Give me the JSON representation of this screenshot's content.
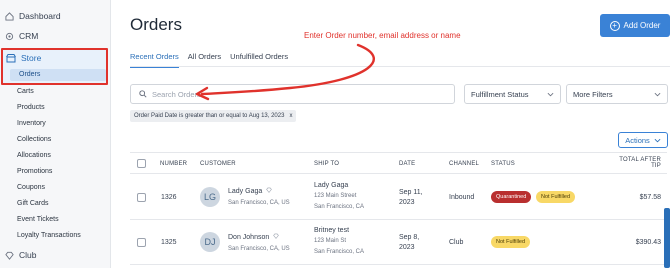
{
  "sidebar": {
    "items": [
      {
        "label": "Dashboard",
        "icon": "home-icon"
      },
      {
        "label": "CRM",
        "icon": "gear-icon"
      },
      {
        "label": "Store",
        "icon": "store-icon"
      },
      {
        "label": "Club",
        "icon": "diamond-icon"
      }
    ],
    "active_sub": "Orders",
    "store_sub": [
      "Carts",
      "Products",
      "Inventory",
      "Collections",
      "Allocations",
      "Promotions",
      "Coupons",
      "Gift Cards",
      "Event Tickets",
      "Loyalty Transactions"
    ]
  },
  "header": {
    "title": "Orders",
    "add_label": "Add Order"
  },
  "tabs": [
    "Recent Orders",
    "All Orders",
    "Unfulfilled Orders"
  ],
  "annotation": "Enter Order number, email address or name",
  "search": {
    "placeholder": "Search Orders"
  },
  "filters": {
    "fulfillment": "Fulfillment Status",
    "more": "More Filters"
  },
  "chip": {
    "label": "Order Paid Date is greater than or equal to Aug 13, 2023",
    "close": "x"
  },
  "actions_label": "Actions",
  "table": {
    "headers": [
      "NUMBER",
      "CUSTOMER",
      "SHIP TO",
      "DATE",
      "CHANNEL",
      "STATUS",
      "TOTAL AFTER",
      "TIP"
    ],
    "rows": [
      {
        "number": "1326",
        "initials": "LG",
        "customer": "Lady Gaga",
        "customer_loc": "San Francisco, CA, US",
        "ship_name": "Lady Gaga",
        "ship_street": "123 Main Street",
        "ship_city": "San Francisco, CA",
        "date_md": "Sep 11,",
        "date_y": "2023",
        "channel": "Inbound",
        "badges": [
          "Quarantined",
          "Not Fulfilled"
        ],
        "total": "$57.58"
      },
      {
        "number": "1325",
        "initials": "DJ",
        "customer": "Don Johnson",
        "customer_loc": "San Francisco, CA, US",
        "ship_name": "Britney test",
        "ship_street": "123 Main St",
        "ship_city": "San Francisco, CA",
        "date_md": "Sep 8,",
        "date_y": "2023",
        "channel": "Club",
        "badges": [
          "Not Fulfilled"
        ],
        "total": "$390.43"
      }
    ]
  },
  "colors": {
    "accent": "#3a82d6",
    "annotation": "#e0322c",
    "quarantined": "#b92f2f",
    "not_fulfilled": "#f8d866"
  }
}
